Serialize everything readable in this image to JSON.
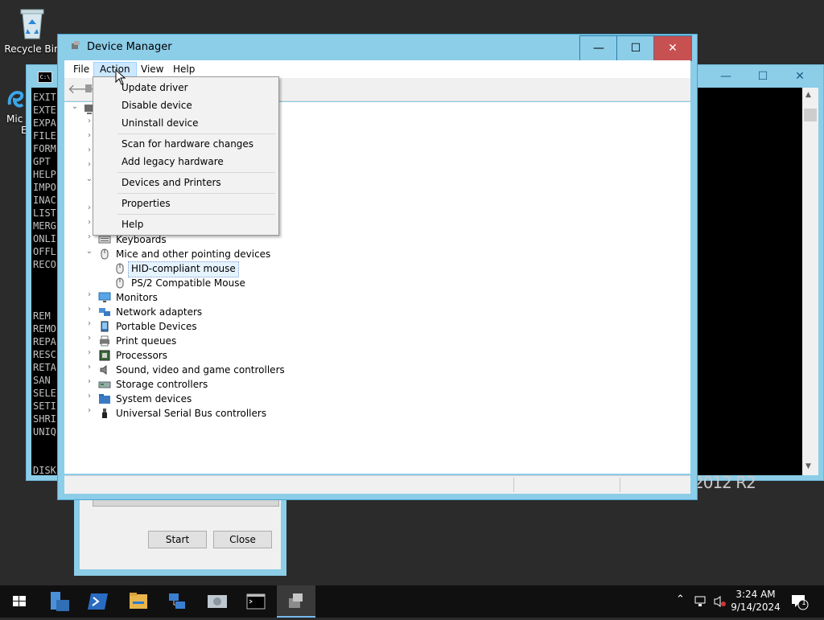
{
  "desktop": {
    "recycle_bin_label": "Recycle Bin",
    "icon2_label_line1": "Mic",
    "icon2_label_line2": "E"
  },
  "cmd": {
    "lines": [
      "EXIT",
      "EXTE",
      "EXPA",
      "FILE",
      "FORM",
      "GPT",
      "HELP",
      "IMPO",
      "INAC",
      "LIST",
      "MERG",
      "ONLI",
      "OFFL",
      "RECO",
      "",
      "",
      "",
      "REM",
      "REMO",
      "REPA",
      "RESC",
      "RETA",
      "SAN",
      "SELE",
      "SETI",
      "SHRI",
      "UNIQ",
      "",
      "",
      "DISK"
    ],
    "min_symbol": "—",
    "max_symbol": "☐",
    "close_symbol": "✕",
    "bg_text": "2012 R2"
  },
  "dialog": {
    "start_label": "Start",
    "close_label": "Close"
  },
  "device_manager": {
    "title": "Device Manager",
    "min_symbol": "—",
    "max_symbol": "☐",
    "close_symbol": "✕",
    "menu": [
      "File",
      "Action",
      "View",
      "Help"
    ],
    "active_menu": "Action",
    "tree": [
      {
        "label": "Keyboards",
        "expanded": false,
        "icon": "keyboard-icon"
      },
      {
        "label": "Mice and other pointing devices",
        "expanded": true,
        "icon": "mouse-icon",
        "children": [
          {
            "label": "HID-compliant mouse",
            "selected": true,
            "icon": "mouse-icon"
          },
          {
            "label": "PS/2 Compatible Mouse",
            "selected": false,
            "icon": "mouse-icon"
          }
        ]
      },
      {
        "label": "Monitors",
        "expanded": false,
        "icon": "monitor-icon"
      },
      {
        "label": "Network adapters",
        "expanded": false,
        "icon": "network-icon"
      },
      {
        "label": "Portable Devices",
        "expanded": false,
        "icon": "portable-device-icon"
      },
      {
        "label": "Print queues",
        "expanded": false,
        "icon": "printer-icon"
      },
      {
        "label": "Processors",
        "expanded": false,
        "icon": "processor-icon"
      },
      {
        "label": "Sound, video and game controllers",
        "expanded": false,
        "icon": "speaker-icon"
      },
      {
        "label": "Storage controllers",
        "expanded": false,
        "icon": "storage-icon"
      },
      {
        "label": "System devices",
        "expanded": false,
        "icon": "system-folder-icon"
      },
      {
        "label": "Universal Serial Bus controllers",
        "expanded": false,
        "icon": "usb-icon"
      }
    ]
  },
  "action_menu": {
    "items": [
      {
        "label": "Update driver"
      },
      {
        "label": "Disable device"
      },
      {
        "label": "Uninstall device"
      },
      {
        "separator": true
      },
      {
        "label": "Scan for hardware changes"
      },
      {
        "label": "Add legacy hardware"
      },
      {
        "separator": true
      },
      {
        "label": "Devices and Printers"
      },
      {
        "separator": true
      },
      {
        "label": "Properties"
      },
      {
        "separator": true
      },
      {
        "label": "Help"
      }
    ]
  },
  "taskbar": {
    "apps": [
      "start-icon",
      "server-manager-icon",
      "powershell-icon",
      "file-explorer-icon",
      "network-tool-icon",
      "disk-tool-icon",
      "command-prompt-icon",
      "device-manager-icon"
    ],
    "active_app": "device-manager-icon",
    "time": "3:24 AM",
    "date": "9/14/2024",
    "notification_count": "1",
    "accent": "#76b9ed"
  }
}
